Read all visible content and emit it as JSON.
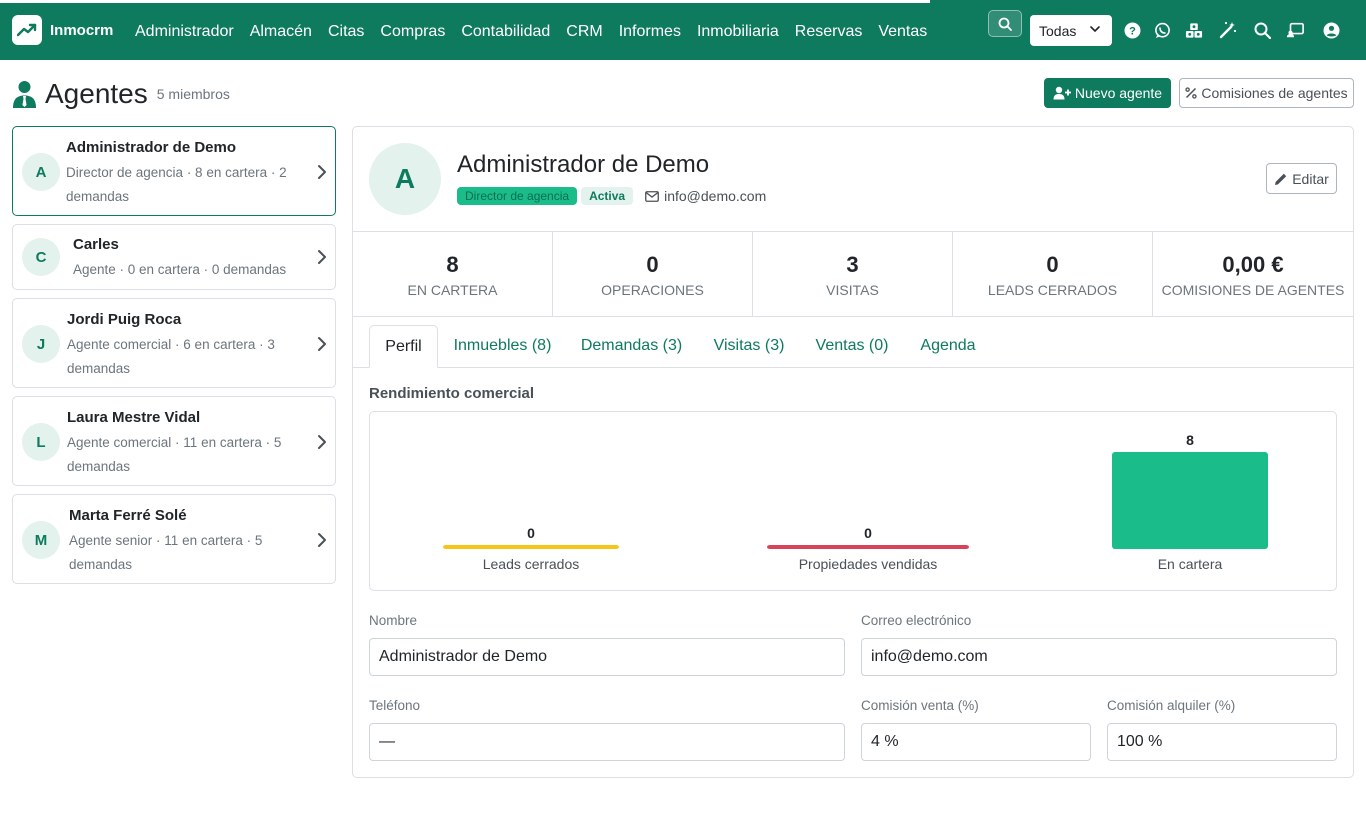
{
  "topbar": {
    "brand": "Inmocrm",
    "nav": [
      "Administrador",
      "Almacén",
      "Citas",
      "Compras",
      "Contabilidad",
      "CRM",
      "Informes",
      "Inmobiliaria",
      "Reservas",
      "Ventas"
    ],
    "scope_select": "Todas",
    "icons": [
      "help-icon",
      "whatsapp-icon",
      "modules-icon",
      "magic-wand-icon",
      "search-icon",
      "cast-icon",
      "user-icon"
    ]
  },
  "page": {
    "title": "Agentes",
    "count": "5 miembros",
    "new_agent_label": "Nuevo agente",
    "commissions_label": "Comisiones de agentes"
  },
  "agents": [
    {
      "initial": "A",
      "name": "Administrador de Demo",
      "sub": "Director de agencia · 8 en cartera · 2 demandas"
    },
    {
      "initial": "C",
      "name": "Carles",
      "sub": "Agente · 0 en cartera · 0 demandas"
    },
    {
      "initial": "J",
      "name": "Jordi Puig Roca",
      "sub": "Agente comercial · 6 en cartera · 3 demandas"
    },
    {
      "initial": "L",
      "name": "Laura Mestre Vidal",
      "sub": "Agente comercial · 11 en cartera · 5 demandas"
    },
    {
      "initial": "M",
      "name": "Marta Ferré Solé",
      "sub": "Agente senior · 11 en cartera · 5 demandas"
    }
  ],
  "detail": {
    "initial": "A",
    "name": "Administrador de Demo",
    "role_badge": "Director de agencia",
    "status_badge": "Activa",
    "email": "info@demo.com",
    "edit_label": "Editar",
    "stats": [
      {
        "value": "8",
        "label": "EN CARTERA"
      },
      {
        "value": "0",
        "label": "OPERACIONES"
      },
      {
        "value": "3",
        "label": "VISITAS"
      },
      {
        "value": "0",
        "label": "LEADS CERRADOS"
      },
      {
        "value": "0,00 €",
        "label": "COMISIONES DE AGENTES"
      }
    ],
    "tabs": [
      "Perfil",
      "Inmuebles (8)",
      "Demandas (3)",
      "Visitas (3)",
      "Ventas (0)",
      "Agenda"
    ],
    "section_title": "Rendimiento comercial",
    "form": {
      "name_label": "Nombre",
      "name_value": "Administrador de Demo",
      "email_label": "Correo electrónico",
      "email_value": "info@demo.com",
      "phone_label": "Teléfono",
      "phone_value": "—",
      "sale_comm_label": "Comisión venta (%)",
      "sale_comm_value": "4 %",
      "rent_comm_label": "Comisión alquiler (%)",
      "rent_comm_value": "100 %"
    }
  },
  "colors": {
    "brand": "#0e7a5e",
    "bar_leads": "#f5c518",
    "bar_sold": "#d9435a",
    "bar_portfolio": "#1abc8a"
  },
  "chart_data": {
    "type": "bar",
    "categories": [
      "Leads cerrados",
      "Propiedades vendidas",
      "En cartera"
    ],
    "values": [
      0,
      0,
      8
    ],
    "title": "",
    "xlabel": "",
    "ylabel": "",
    "colors": [
      "#f5c518",
      "#d9435a",
      "#1abc8a"
    ]
  }
}
